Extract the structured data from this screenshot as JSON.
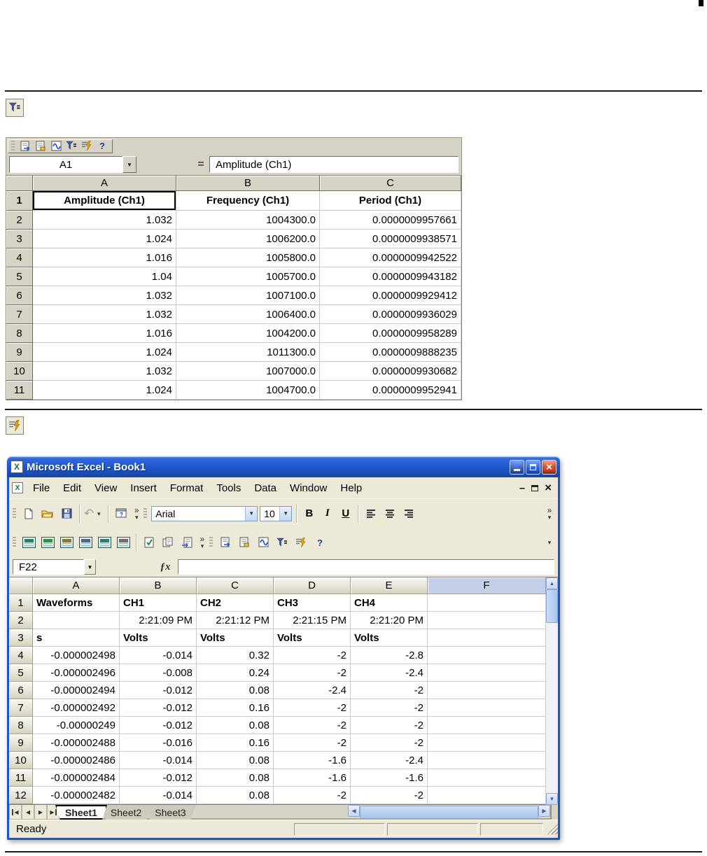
{
  "icons": {
    "dropdown": "▼",
    "more": "▾",
    "overflow": "»",
    "undo": "↶",
    "fx": "ƒx",
    "excel_x": "X",
    "check": "✓",
    "help": "?",
    "minimize": "–",
    "close": "×",
    "up": "▲",
    "down": "▼",
    "left": "◀",
    "right": "▶"
  },
  "fragment1": {
    "name_box": "A1",
    "equals": "=",
    "formula": "Amplitude (Ch1)",
    "columns": [
      "A",
      "B",
      "C"
    ],
    "rows": [
      {
        "num": "1",
        "hb": true,
        "bold": true,
        "align": "center",
        "active": 0,
        "cells": [
          "Amplitude (Ch1)",
          "Frequency (Ch1)",
          "Period (Ch1)"
        ]
      },
      {
        "num": "2",
        "cells": [
          "1.032",
          "1004300.0",
          "0.0000009957661"
        ]
      },
      {
        "num": "3",
        "cells": [
          "1.024",
          "1006200.0",
          "0.0000009938571"
        ]
      },
      {
        "num": "4",
        "cells": [
          "1.016",
          "1005800.0",
          "0.0000009942522"
        ]
      },
      {
        "num": "5",
        "cells": [
          "1.04",
          "1005700.0",
          "0.0000009943182"
        ]
      },
      {
        "num": "6",
        "cells": [
          "1.032",
          "1007100.0",
          "0.0000009929412"
        ]
      },
      {
        "num": "7",
        "cells": [
          "1.032",
          "1006400.0",
          "0.0000009936029"
        ]
      },
      {
        "num": "8",
        "cells": [
          "1.016",
          "1004200.0",
          "0.0000009958289"
        ]
      },
      {
        "num": "9",
        "cells": [
          "1.024",
          "1011300.0",
          "0.0000009888235"
        ]
      },
      {
        "num": "10",
        "cells": [
          "1.032",
          "1007000.0",
          "0.0000009930682"
        ]
      },
      {
        "num": "11",
        "cells": [
          "1.024",
          "1004700.0",
          "0.0000009952941"
        ]
      }
    ]
  },
  "excel": {
    "title": "Microsoft Excel - Book1",
    "menus": [
      "File",
      "Edit",
      "View",
      "Insert",
      "Format",
      "Tools",
      "Data",
      "Window",
      "Help"
    ],
    "toolbar": {
      "font_name": "Arial",
      "font_size": "10",
      "bold": "B",
      "italic": "I",
      "underline": "U"
    },
    "name_box": "F22",
    "columns": [
      "A",
      "B",
      "C",
      "D",
      "E",
      "F"
    ],
    "rows": [
      {
        "num": "1",
        "bold": true,
        "align": "left",
        "cells": [
          "Waveforms",
          "CH1",
          "CH2",
          "CH3",
          "CH4",
          ""
        ]
      },
      {
        "num": "2",
        "align": "right",
        "cells": [
          "",
          "2:21:09 PM",
          "2:21:12 PM",
          "2:21:15 PM",
          "2:21:20 PM",
          ""
        ]
      },
      {
        "num": "3",
        "bold": true,
        "align": "left",
        "cells": [
          "s",
          "Volts",
          "Volts",
          "Volts",
          "Volts",
          ""
        ]
      },
      {
        "num": "4",
        "cells": [
          "-0.000002498",
          "-0.014",
          "0.32",
          "-2",
          "-2.8",
          ""
        ]
      },
      {
        "num": "5",
        "cells": [
          "-0.000002496",
          "-0.008",
          "0.24",
          "-2",
          "-2.4",
          ""
        ]
      },
      {
        "num": "6",
        "cells": [
          "-0.000002494",
          "-0.012",
          "0.08",
          "-2.4",
          "-2",
          ""
        ]
      },
      {
        "num": "7",
        "cells": [
          "-0.000002492",
          "-0.012",
          "0.16",
          "-2",
          "-2",
          ""
        ]
      },
      {
        "num": "8",
        "cells": [
          "-0.00000249",
          "-0.012",
          "0.08",
          "-2",
          "-2",
          ""
        ]
      },
      {
        "num": "9",
        "cells": [
          "-0.000002488",
          "-0.016",
          "0.16",
          "-2",
          "-2",
          ""
        ]
      },
      {
        "num": "10",
        "cells": [
          "-0.000002486",
          "-0.014",
          "0.08",
          "-1.6",
          "-2.4",
          ""
        ]
      },
      {
        "num": "11",
        "cells": [
          "-0.000002484",
          "-0.012",
          "0.08",
          "-1.6",
          "-1.6",
          ""
        ]
      },
      {
        "num": "12",
        "cells": [
          "-0.000002482",
          "-0.014",
          "0.08",
          "-2",
          "-2",
          ""
        ]
      }
    ],
    "sheet_tabs": [
      "Sheet1",
      "Sheet2",
      "Sheet3"
    ],
    "status": "Ready"
  }
}
